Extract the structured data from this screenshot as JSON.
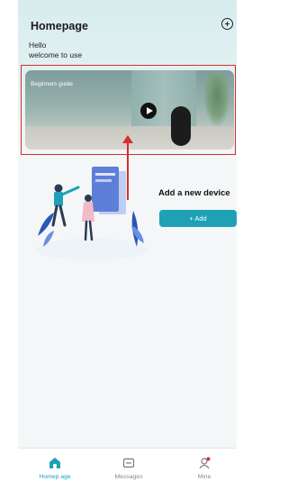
{
  "header": {
    "title": "Homepage",
    "add_icon": "plus-circle-icon"
  },
  "greeting": {
    "hello": "Hello",
    "welcome": "welcome to use"
  },
  "banner": {
    "label": "Beginners guide",
    "play_icon": "play-icon",
    "highlight_color": "#d62d2d"
  },
  "add_device": {
    "title": "Add a new device",
    "button_label": "+ Add",
    "accent": "#1fa1b5"
  },
  "tabs": [
    {
      "label": "Homep age",
      "icon": "home-icon",
      "active": true
    },
    {
      "label": "Messages",
      "icon": "message-icon",
      "active": false
    },
    {
      "label": "Mine",
      "icon": "profile-icon",
      "active": false
    }
  ]
}
